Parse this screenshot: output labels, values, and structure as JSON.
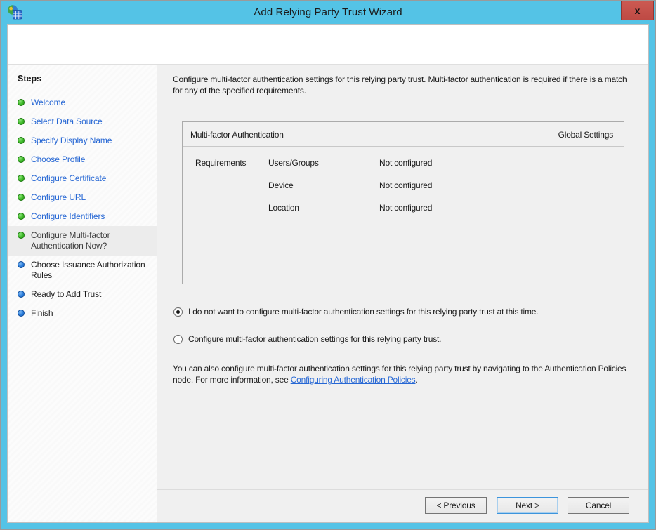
{
  "window": {
    "title": "Add Relying Party Trust Wizard",
    "close_glyph": "x"
  },
  "sidebar": {
    "heading": "Steps",
    "steps": [
      {
        "label": "Welcome",
        "state": "done"
      },
      {
        "label": "Select Data Source",
        "state": "done"
      },
      {
        "label": "Specify Display Name",
        "state": "done"
      },
      {
        "label": "Choose Profile",
        "state": "done"
      },
      {
        "label": "Configure Certificate",
        "state": "done"
      },
      {
        "label": "Configure URL",
        "state": "done"
      },
      {
        "label": "Configure Identifiers",
        "state": "done"
      },
      {
        "label": "Configure Multi-factor Authentication Now?",
        "state": "current"
      },
      {
        "label": "Choose Issuance Authorization Rules",
        "state": "upcoming"
      },
      {
        "label": "Ready to Add Trust",
        "state": "upcoming"
      },
      {
        "label": "Finish",
        "state": "upcoming"
      }
    ]
  },
  "main": {
    "intro": "Configure multi-factor authentication settings for this relying party trust. Multi-factor authentication is required if there is a match for any of the specified requirements.",
    "table": {
      "title": "Multi-factor Authentication",
      "right_header": "Global Settings",
      "row_group_label": "Requirements",
      "rows": [
        {
          "name": "Users/Groups",
          "value": "Not configured"
        },
        {
          "name": "Device",
          "value": "Not configured"
        },
        {
          "name": "Location",
          "value": "Not configured"
        }
      ]
    },
    "radios": [
      {
        "label": "I do not want to configure multi-factor authentication settings for this relying party trust at this time.",
        "selected": true
      },
      {
        "label": "Configure multi-factor authentication settings for this relying party trust.",
        "selected": false
      }
    ],
    "footnote": {
      "text_before": "You can also configure multi-factor authentication settings for this relying party trust by navigating to the Authentication Policies node. For more information, see ",
      "link": "Configuring Authentication Policies",
      "text_after": "."
    }
  },
  "buttons": {
    "previous": "< Previous",
    "next": "Next >",
    "cancel": "Cancel"
  },
  "colors": {
    "titlebar_blue": "#54C3E6",
    "close_red": "#C75050",
    "link_blue": "#2667D4",
    "done_bullet_green": "#3DBA28",
    "upcoming_bullet_blue": "#2B7EDC",
    "current_step_bg": "#ECECEC",
    "main_bg": "#F0F0F0"
  }
}
